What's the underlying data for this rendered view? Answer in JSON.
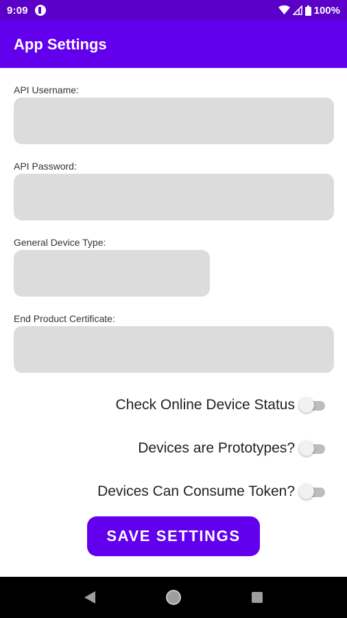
{
  "status_bar": {
    "time": "9:09",
    "battery": "100%",
    "icons": [
      "app-notification-icon",
      "wifi-icon",
      "signal-icon",
      "battery-icon"
    ]
  },
  "app_bar": {
    "title": "App Settings",
    "color": "#6200ee"
  },
  "form": {
    "fields": [
      {
        "label": "API Username:",
        "value": ""
      },
      {
        "label": "API Password:",
        "value": ""
      },
      {
        "label": "General Device Type:",
        "value": ""
      },
      {
        "label": "End Product Certificate:",
        "value": ""
      }
    ],
    "toggles": [
      {
        "label": "Check Online Device Status",
        "checked": false
      },
      {
        "label": "Devices are Prototypes?",
        "checked": false
      },
      {
        "label": "Devices Can Consume Token?",
        "checked": false
      }
    ],
    "save_label": "SAVE SETTINGS"
  },
  "nav_bar": {
    "buttons": [
      "back-icon",
      "home-icon",
      "recents-icon"
    ]
  }
}
